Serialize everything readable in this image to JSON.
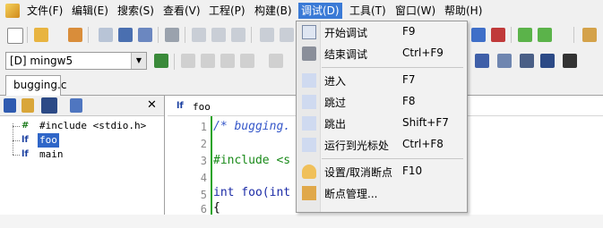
{
  "menubar": {
    "items": [
      {
        "label": "文件(F)"
      },
      {
        "label": "编辑(E)"
      },
      {
        "label": "搜索(S)"
      },
      {
        "label": "查看(V)"
      },
      {
        "label": "工程(P)"
      },
      {
        "label": "构建(B)"
      },
      {
        "label": "调试(D)"
      },
      {
        "label": "工具(T)"
      },
      {
        "label": "窗口(W)"
      },
      {
        "label": "帮助(H)"
      }
    ],
    "active_index": 6
  },
  "toolbar": {
    "compiler_value": "[D] mingw5"
  },
  "file_tab": {
    "label": "bugging.c"
  },
  "class_tree": {
    "items": [
      {
        "icon": "#",
        "label": "#include <stdio.h>"
      },
      {
        "icon": "lf",
        "label": "foo"
      },
      {
        "icon": "lf",
        "label": "main"
      }
    ]
  },
  "editor_nav": {
    "function": "foo"
  },
  "editor": {
    "lines": [
      {
        "number": "1",
        "text": "/* bugging."
      },
      {
        "number": "2",
        "text": ""
      },
      {
        "number": "3",
        "text": "#include <s"
      },
      {
        "number": "4",
        "text": ""
      },
      {
        "number": "5",
        "text": "int foo(int"
      },
      {
        "number": "6",
        "text": "{"
      }
    ]
  },
  "debug_menu": {
    "items": [
      {
        "label": "开始调试",
        "shortcut": "F9",
        "icon": "start-debug-icon"
      },
      {
        "label": "结束调试",
        "shortcut": "Ctrl+F9",
        "icon": "stop-debug-icon"
      },
      {
        "label": "进入",
        "shortcut": "F7",
        "icon": "step-into-icon"
      },
      {
        "label": "跳过",
        "shortcut": "F8",
        "icon": "step-over-icon"
      },
      {
        "label": "跳出",
        "shortcut": "Shift+F7",
        "icon": "step-out-icon"
      },
      {
        "label": "运行到光标处",
        "shortcut": "Ctrl+F8",
        "icon": "run-to-cursor-icon"
      },
      {
        "label": "设置/取消断点",
        "shortcut": "F10",
        "icon": "toggle-breakpoint-icon"
      },
      {
        "label": "断点管理...",
        "shortcut": "",
        "icon": "breakpoint-manager-icon"
      }
    ]
  },
  "colors": {
    "menu_highlight": "#3a7ad6",
    "gutter_marker": "#23a31e",
    "comment": "#3456c9",
    "preprocessor": "#1a8a1a"
  }
}
